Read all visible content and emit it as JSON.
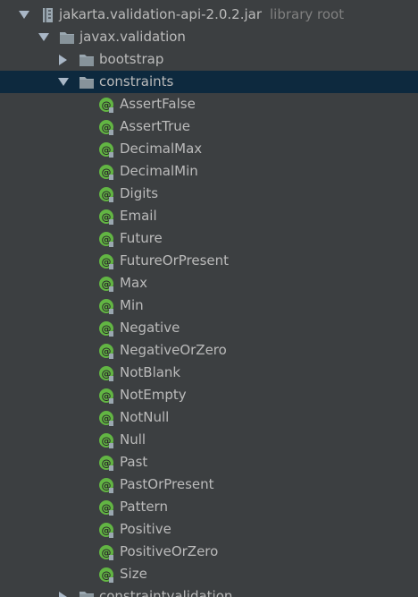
{
  "tree": {
    "jar": {
      "label": "jakarta.validation-api-2.0.2.jar",
      "hint": "library root"
    },
    "package": {
      "label": "javax.validation"
    },
    "bootstrap": {
      "label": "bootstrap"
    },
    "constraints": {
      "label": "constraints",
      "items": [
        {
          "label": "AssertFalse"
        },
        {
          "label": "AssertTrue"
        },
        {
          "label": "DecimalMax"
        },
        {
          "label": "DecimalMin"
        },
        {
          "label": "Digits"
        },
        {
          "label": "Email"
        },
        {
          "label": "Future"
        },
        {
          "label": "FutureOrPresent"
        },
        {
          "label": "Max"
        },
        {
          "label": "Min"
        },
        {
          "label": "Negative"
        },
        {
          "label": "NegativeOrZero"
        },
        {
          "label": "NotBlank"
        },
        {
          "label": "NotEmpty"
        },
        {
          "label": "NotNull"
        },
        {
          "label": "Null"
        },
        {
          "label": "Past"
        },
        {
          "label": "PastOrPresent"
        },
        {
          "label": "Pattern"
        },
        {
          "label": "Positive"
        },
        {
          "label": "PositiveOrZero"
        },
        {
          "label": "Size"
        }
      ]
    },
    "constraintvalidation": {
      "label": "constraintvalidation"
    }
  },
  "colors": {
    "background": "#3c3f41",
    "selection": "#0d293e",
    "text": "#bbbbbb",
    "hint": "#808080",
    "annotation_icon": "#62b543"
  }
}
